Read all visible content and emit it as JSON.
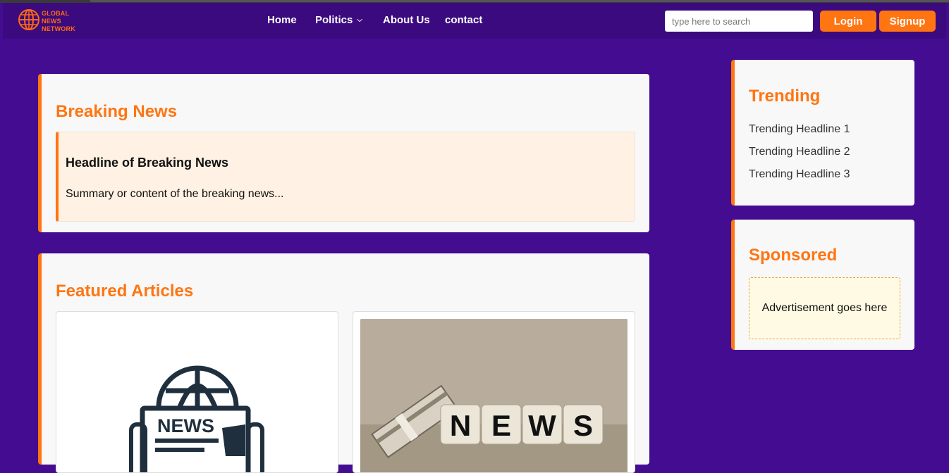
{
  "header": {
    "logo_text": [
      "GLOBAL",
      "NEWS",
      "NETWORK"
    ],
    "nav": [
      {
        "label": "Home"
      },
      {
        "label": "Politics"
      },
      {
        "label": "About Us"
      },
      {
        "label": "contact"
      }
    ],
    "search_placeholder": "type here to search",
    "login_label": "Login",
    "signup_label": "Signup"
  },
  "breaking": {
    "title": "Breaking News",
    "headline": "Headline of Breaking News",
    "summary": "Summary or content of the breaking news..."
  },
  "featured": {
    "title": "Featured Articles",
    "article_1_image_text": "NEWS",
    "article_2_image_text": "NEWS"
  },
  "trending": {
    "title": "Trending",
    "items": [
      "Trending Headline 1",
      "Trending Headline 2",
      "Trending Headline 3"
    ]
  },
  "sponsored": {
    "title": "Sponsored",
    "ad_text": "Advertisement goes here"
  },
  "colors": {
    "background": "#430c91",
    "navbar": "#3b0a7f",
    "accent": "#ff7512",
    "card": "#f8f8f8"
  }
}
